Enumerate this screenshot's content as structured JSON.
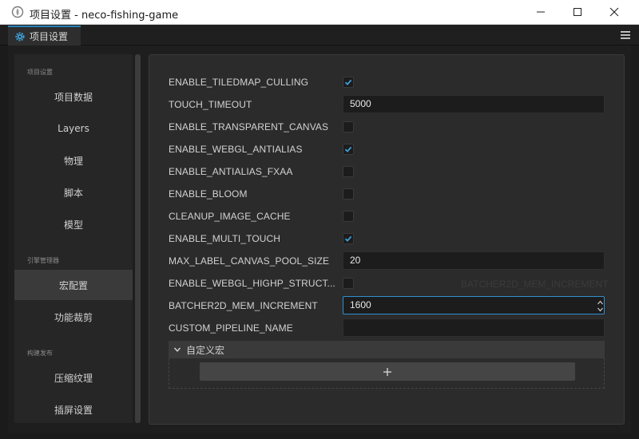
{
  "window": {
    "title": "项目设置 - neco-fishing-game"
  },
  "tab": {
    "label": "项目设置"
  },
  "sidebar": {
    "sections": [
      {
        "title": "项目设置"
      },
      {
        "title": "引擎管理器"
      },
      {
        "title": "构建发布"
      }
    ],
    "items": [
      {
        "label": "项目数据"
      },
      {
        "label": "Layers"
      },
      {
        "label": "物理"
      },
      {
        "label": "脚本"
      },
      {
        "label": "模型"
      },
      {
        "label": "宏配置",
        "active": true
      },
      {
        "label": "功能裁剪"
      },
      {
        "label": "压缩纹理"
      },
      {
        "label": "插屏设置"
      }
    ]
  },
  "macros": [
    {
      "name": "ENABLE_TILEDMAP_CULLING",
      "type": "checkbox",
      "checked": true
    },
    {
      "name": "TOUCH_TIMEOUT",
      "type": "text",
      "value": "5000"
    },
    {
      "name": "ENABLE_TRANSPARENT_CANVAS",
      "type": "checkbox",
      "checked": false
    },
    {
      "name": "ENABLE_WEBGL_ANTIALIAS",
      "type": "checkbox",
      "checked": true
    },
    {
      "name": "ENABLE_ANTIALIAS_FXAA",
      "type": "checkbox",
      "checked": false
    },
    {
      "name": "ENABLE_BLOOM",
      "type": "checkbox",
      "checked": false
    },
    {
      "name": "CLEANUP_IMAGE_CACHE",
      "type": "checkbox",
      "checked": false
    },
    {
      "name": "ENABLE_MULTI_TOUCH",
      "type": "checkbox",
      "checked": true
    },
    {
      "name": "MAX_LABEL_CANVAS_POOL_SIZE",
      "type": "text",
      "value": "20"
    },
    {
      "name": "ENABLE_WEBGL_HIGHP_STRUCT...",
      "type": "checkbox",
      "checked": false
    },
    {
      "name": "BATCHER2D_MEM_INCREMENT",
      "type": "number",
      "value": "1600",
      "focused": true
    },
    {
      "name": "CUSTOM_PIPELINE_NAME",
      "type": "text",
      "value": ""
    }
  ],
  "tooltip_ghost": "BATCHER2D_MEM_INCREMENT",
  "custom_macros": {
    "label": "自定义宏",
    "add_label": "+"
  },
  "colors": {
    "accent": "#2f8fce",
    "panel": "#2b2b2b",
    "input_bg": "#1c1c1c",
    "text": "#d2d2d2"
  },
  "icons": {
    "app": "cocos-logo-icon",
    "tab": "gear-icon",
    "menu": "hamburger-menu-icon",
    "minimize": "minimize-icon",
    "maximize": "maximize-icon",
    "close": "close-icon",
    "checkbox": "checkmark-icon",
    "collapse": "chevron-down-icon"
  }
}
